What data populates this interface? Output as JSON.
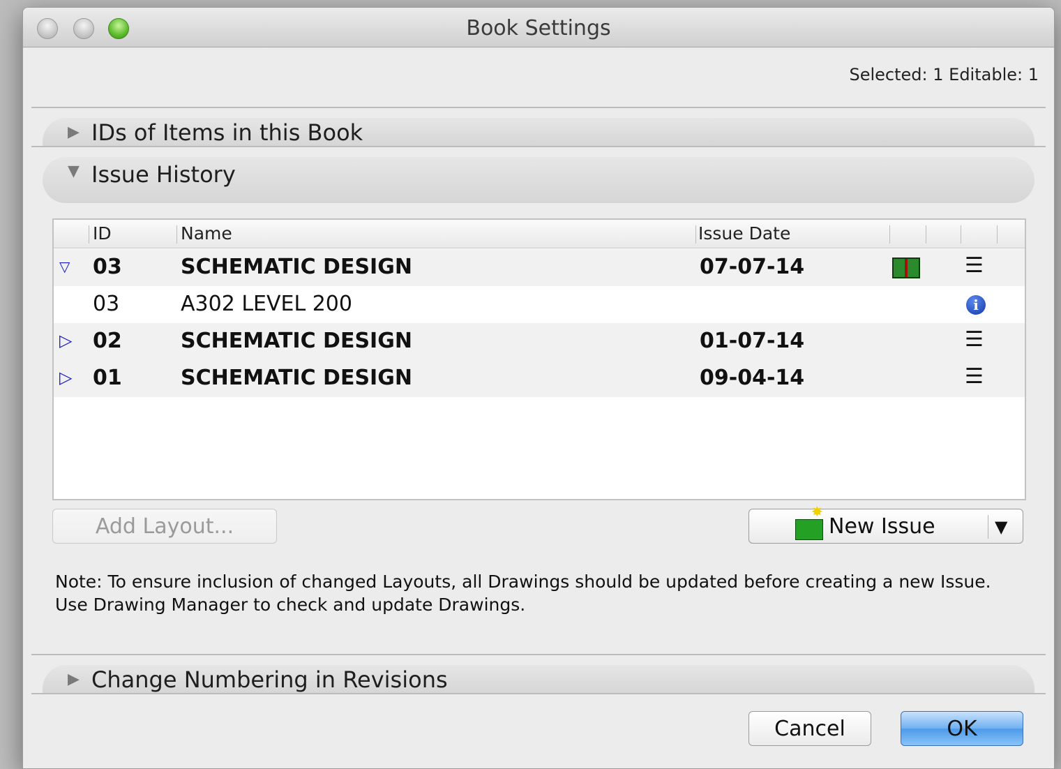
{
  "window": {
    "title": "Book Settings"
  },
  "status": "Selected: 1 Editable: 1",
  "sections": {
    "ids": {
      "label": "IDs of Items in this Book"
    },
    "issue_history": {
      "label": "Issue History"
    },
    "change_numbering": {
      "label": "Change Numbering in Revisions"
    }
  },
  "table": {
    "columns": {
      "id": "ID",
      "name": "Name",
      "date": "Issue Date"
    },
    "rows": [
      {
        "id": "03",
        "name": "SCHEMATIC DESIGN",
        "date": "07-07-14",
        "bold": true,
        "expander": "expanded",
        "icons": [
          "book-icon",
          "list-icon"
        ]
      },
      {
        "id": "03",
        "name": "A302 LEVEL 200",
        "date": "",
        "bold": false,
        "expander": "none",
        "icons": [
          "info-icon"
        ]
      },
      {
        "id": "02",
        "name": "SCHEMATIC DESIGN",
        "date": "01-07-14",
        "bold": true,
        "expander": "collapsed",
        "icons": [
          "list-icon"
        ]
      },
      {
        "id": "01",
        "name": "SCHEMATIC DESIGN",
        "date": "09-04-14",
        "bold": true,
        "expander": "collapsed",
        "icons": [
          "list-icon"
        ]
      }
    ]
  },
  "buttons": {
    "add_layout": "Add Layout...",
    "new_issue": "New Issue",
    "cancel": "Cancel",
    "ok": "OK"
  },
  "note": "Note: To ensure inclusion of changed Layouts, all Drawings should be updated before creating a new Issue. Use Drawing Manager to check and update Drawings.",
  "colors": {
    "primary_button": "#6fb0f1",
    "expander": "#1a1ac0"
  }
}
